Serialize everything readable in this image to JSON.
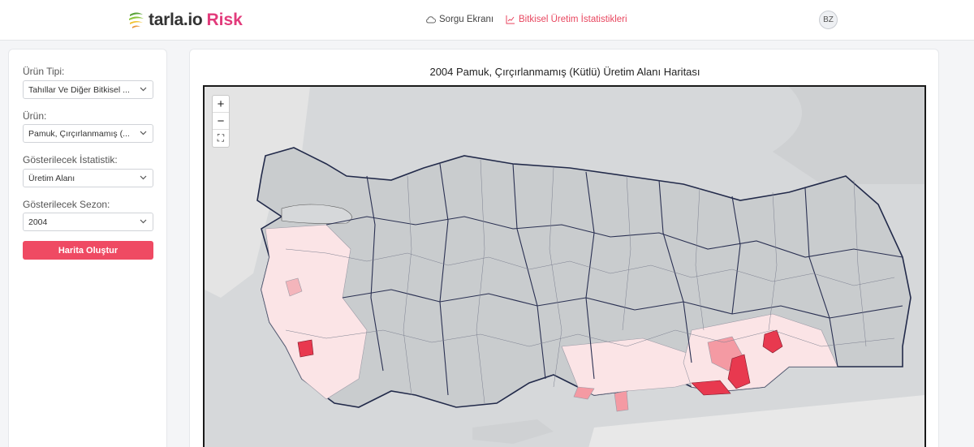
{
  "header": {
    "logo_text": "tarla.io",
    "logo_accent": "Risk",
    "nav": [
      {
        "label": "Sorgu Ekranı",
        "icon": "cloud-icon"
      },
      {
        "label": "Bitkisel Üretim İstatistikleri",
        "icon": "chart-icon"
      }
    ],
    "user_initials": "BZ"
  },
  "sidebar": {
    "fields": [
      {
        "label": "Ürün Tipi:",
        "value": "Tahıllar Ve Diğer Bitkisel ..."
      },
      {
        "label": "Ürün:",
        "value": "Pamuk, Çırçırlanmamış (..."
      },
      {
        "label": "Gösterilecek İstatistik:",
        "value": "Üretim Alanı"
      },
      {
        "label": "Gösterilecek Sezon:",
        "value": "2004"
      }
    ],
    "submit_label": "Harita Oluştur"
  },
  "map": {
    "title": "2004 Pamuk, Çırçırlanmamış (Kütlü) Üretim Alanı Haritası",
    "zoom_in": "+",
    "zoom_out": "−",
    "fullscreen": "⛶"
  },
  "colors": {
    "accent": "#ef4a63",
    "sea": "#d6d8da",
    "land": "#c9ccce",
    "highlight_high": "#e8394f",
    "highlight_mid": "#f49aa3",
    "highlight_low": "#fde3e5"
  }
}
